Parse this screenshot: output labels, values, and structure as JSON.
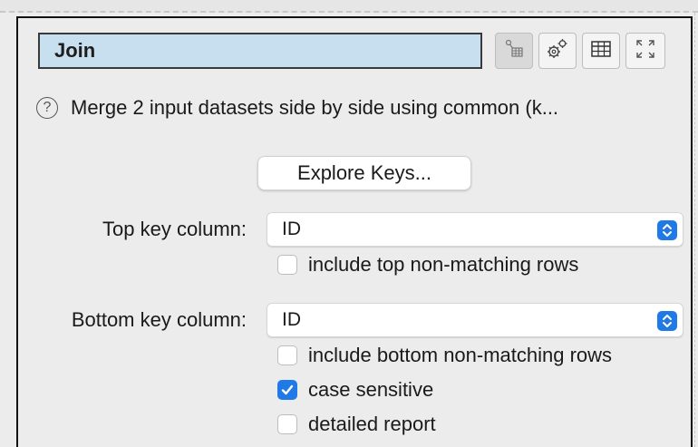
{
  "widget": {
    "title": "Join",
    "toolbar": {
      "buttons": [
        {
          "name": "link-table-icon"
        },
        {
          "name": "gears-icon"
        },
        {
          "name": "table-icon"
        },
        {
          "name": "expand-icon"
        }
      ]
    },
    "help_text": "Merge 2 input datasets side by side using common (k...",
    "explore_button": "Explore Keys...",
    "top_key": {
      "label": "Top key column:",
      "value": "ID",
      "option_label": "include top non-matching rows",
      "option_checked": false
    },
    "bottom_key": {
      "label": "Bottom key column:",
      "value": "ID",
      "option_label": "include bottom non-matching rows",
      "option_checked": false
    },
    "case_sensitive": {
      "label": "case sensitive",
      "checked": true
    },
    "detailed_report": {
      "label": "detailed report",
      "checked": false
    }
  },
  "colors": {
    "title_bg": "#c8dff0",
    "accent": "#1f7ae8"
  }
}
